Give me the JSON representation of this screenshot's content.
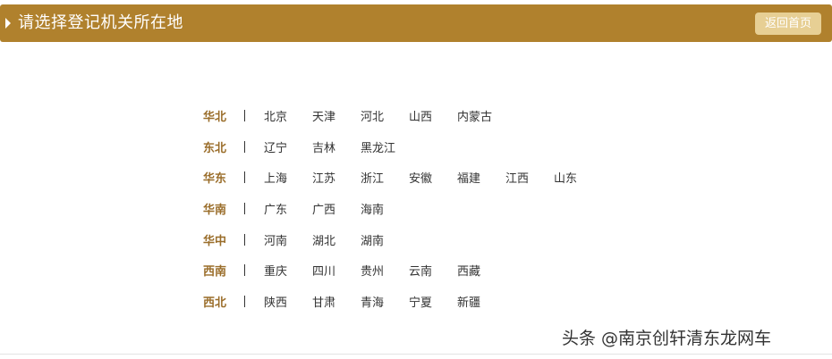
{
  "header": {
    "title": "请选择登记机关所在地",
    "back_label": "返回首页"
  },
  "regions": [
    {
      "name": "华北",
      "provinces": [
        "北京",
        "天津",
        "河北",
        "山西",
        "内蒙古"
      ]
    },
    {
      "name": "东北",
      "provinces": [
        "辽宁",
        "吉林",
        "黑龙江"
      ]
    },
    {
      "name": "华东",
      "provinces": [
        "上海",
        "江苏",
        "浙江",
        "安徽",
        "福建",
        "江西",
        "山东"
      ]
    },
    {
      "name": "华南",
      "provinces": [
        "广东",
        "广西",
        "海南"
      ]
    },
    {
      "name": "华中",
      "provinces": [
        "河南",
        "湖北",
        "湖南"
      ]
    },
    {
      "name": "西南",
      "provinces": [
        "重庆",
        "四川",
        "贵州",
        "云南",
        "西藏"
      ]
    },
    {
      "name": "西北",
      "provinces": [
        "陕西",
        "甘肃",
        "青海",
        "宁夏",
        "新疆"
      ]
    }
  ],
  "watermark": "头条 @南京创轩清东龙网车",
  "colors": {
    "header_bg": "#b0812d",
    "button_bg": "#e7cf94",
    "region_label": "#9a6d2a"
  }
}
